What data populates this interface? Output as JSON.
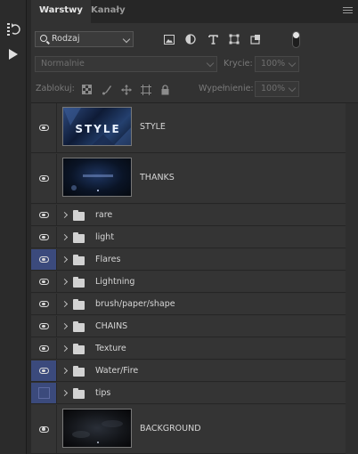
{
  "toolstrip": {
    "items": [
      {
        "name": "history-icon"
      },
      {
        "name": "play-actions-icon"
      }
    ]
  },
  "tabs": [
    {
      "label": "Warstwy",
      "active": true
    },
    {
      "label": "Kanały",
      "active": false
    }
  ],
  "filter": {
    "kind_value": "Rodzaj",
    "icons": [
      "image-filter-icon",
      "adjustment-filter-icon",
      "type-filter-icon",
      "shape-filter-icon",
      "smart-object-filter-icon"
    ]
  },
  "blend": {
    "mode_value": "Normalnie",
    "opacity_label": "Krycie:",
    "opacity_value": "100%"
  },
  "lock": {
    "label": "Zablokuj:",
    "fill_label": "Wypełnienie:",
    "fill_value": "100%"
  },
  "layers": [
    {
      "name": "STYLE",
      "type": "image",
      "visible": true,
      "selected": false,
      "thumb_text": "STYLE"
    },
    {
      "name": "THANKS",
      "type": "image",
      "visible": true,
      "selected": false
    },
    {
      "name": "rare",
      "type": "group",
      "visible": true,
      "selected": false
    },
    {
      "name": "light",
      "type": "group",
      "visible": true,
      "selected": false
    },
    {
      "name": "Flares",
      "type": "group",
      "visible": true,
      "selected": true
    },
    {
      "name": "Lightning",
      "type": "group",
      "visible": true,
      "selected": false
    },
    {
      "name": "brush/paper/shape",
      "type": "group",
      "visible": true,
      "selected": false
    },
    {
      "name": "CHAINS",
      "type": "group",
      "visible": true,
      "selected": false
    },
    {
      "name": "Texture",
      "type": "group",
      "visible": true,
      "selected": false
    },
    {
      "name": "Water/Fire",
      "type": "group",
      "visible": true,
      "selected": true
    },
    {
      "name": "tips",
      "type": "group",
      "visible": false,
      "selected": true
    },
    {
      "name": "BACKGROUND",
      "type": "image",
      "visible": true,
      "selected": false
    }
  ],
  "colors": {
    "panel_bg": "#323232",
    "selected_eye_bg": "#3b4a7c"
  }
}
